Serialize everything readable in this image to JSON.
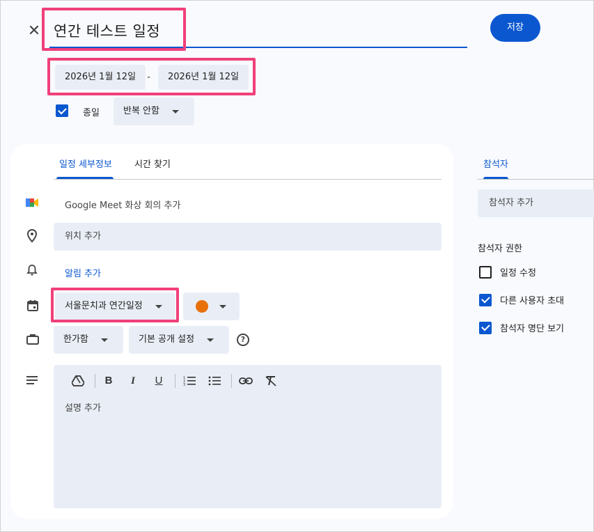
{
  "header": {
    "close_label": "✕",
    "title": "연간 테스트 일정",
    "save_label": "저장"
  },
  "dates": {
    "start": "2026년 1월 12일",
    "separator": "-",
    "end": "2026년 1월 12일"
  },
  "all_day": {
    "label": "종일",
    "checked": true
  },
  "repeat": {
    "value": "반복 안함"
  },
  "tabs": [
    {
      "label": "일정 세부정보",
      "active": true
    },
    {
      "label": "시간 찾기",
      "active": false
    }
  ],
  "details": {
    "meet": "Google Meet 화상 회의 추가",
    "location_placeholder": "위치 추가",
    "notification": "알림 추가",
    "calendar": "서울문치과 연간일정",
    "event_color": "#e8710a",
    "busy_status": "한가함",
    "visibility": "기본 공개 설정",
    "help_icon": "?",
    "description_placeholder": "설명 추가"
  },
  "toolbar": {
    "drive": "drive-icon",
    "bold": "B",
    "italic": "I",
    "underline": "U",
    "numbered_list": "numbered-list-icon",
    "bulleted_list": "bulleted-list-icon",
    "link": "link-icon",
    "clear_format": "clear-format-icon"
  },
  "guests": {
    "tab_label": "참석자",
    "add_placeholder": "참석자 추가",
    "permissions_label": "참석자 권한",
    "permissions": [
      {
        "label": "일정 수정",
        "checked": false
      },
      {
        "label": "다른 사용자 초대",
        "checked": true
      },
      {
        "label": "참석자 명단 보기",
        "checked": true
      }
    ]
  },
  "colors": {
    "accent": "#0b57d0",
    "field_bg": "#e9eef6",
    "highlight": "#f0407a"
  }
}
